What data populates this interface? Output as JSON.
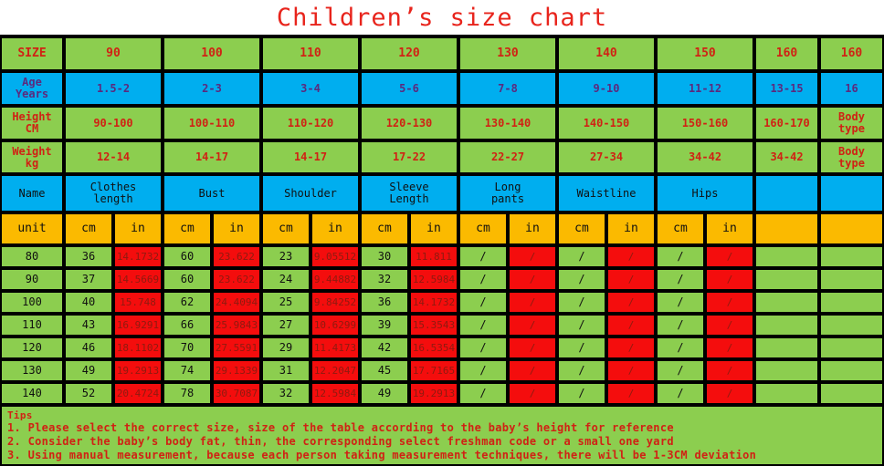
{
  "title": "Children’s size chart",
  "colors": {
    "green": "#8CCE4F",
    "blue": "#00AEEF",
    "orange": "#FBBA00",
    "red": "#F40D0D",
    "title_red": "#E8241C",
    "text_red": "#D02214",
    "text_purple": "#5B2A7E"
  },
  "top_table": {
    "size_row": {
      "label": "SIZE",
      "values": [
        "90",
        "100",
        "110",
        "120",
        "130",
        "140",
        "150",
        "160",
        "160"
      ]
    },
    "age_row": {
      "label": "Age\nYears",
      "values": [
        "1.5-2",
        "2-3",
        "3-4",
        "5-6",
        "7-8",
        "9-10",
        "11-12",
        "13-15",
        "16"
      ]
    },
    "height_row": {
      "label": "Height\nCM",
      "values": [
        "90-100",
        "100-110",
        "110-120",
        "120-130",
        "130-140",
        "140-150",
        "150-160",
        "160-170",
        "Body\ntype"
      ]
    },
    "weight_row": {
      "label": "Weight\nkg",
      "values": [
        "12-14",
        "14-17",
        "14-17",
        "17-22",
        "22-27",
        "27-34",
        "34-42",
        "34-42",
        "Body\ntype"
      ]
    },
    "name_row": {
      "label": "Name",
      "values": [
        "Clothes\nlength",
        "Bust",
        "Shoulder",
        "Sleeve\nLength",
        "Long\npants",
        "Waistline",
        "Hips",
        "",
        ""
      ]
    }
  },
  "measure_table": {
    "unit_row": {
      "label": "unit",
      "cm_label": "cm",
      "in_label": "in",
      "measure_count": 7,
      "empty_cols": 2
    },
    "rows": [
      {
        "size": "80",
        "cells": [
          "36",
          "14.1732",
          "60",
          "23.622",
          "23",
          "9.05512",
          "30",
          "11.811",
          "/",
          "/",
          "/",
          "/",
          "/",
          "/"
        ]
      },
      {
        "size": "90",
        "cells": [
          "37",
          "14.5669",
          "60",
          "23.622",
          "24",
          "9.44882",
          "32",
          "12.5984",
          "/",
          "/",
          "/",
          "/",
          "/",
          "/"
        ]
      },
      {
        "size": "100",
        "cells": [
          "40",
          "15.748",
          "62",
          "24.4094",
          "25",
          "9.84252",
          "36",
          "14.1732",
          "/",
          "/",
          "/",
          "/",
          "/",
          "/"
        ]
      },
      {
        "size": "110",
        "cells": [
          "43",
          "16.9291",
          "66",
          "25.9843",
          "27",
          "10.6299",
          "39",
          "15.3543",
          "/",
          "/",
          "/",
          "/",
          "/",
          "/"
        ]
      },
      {
        "size": "120",
        "cells": [
          "46",
          "18.1102",
          "70",
          "27.5591",
          "29",
          "11.4173",
          "42",
          "16.5354",
          "/",
          "/",
          "/",
          "/",
          "/",
          "/"
        ]
      },
      {
        "size": "130",
        "cells": [
          "49",
          "19.2913",
          "74",
          "29.1339",
          "31",
          "12.2047",
          "45",
          "17.7165",
          "/",
          "/",
          "/",
          "/",
          "/",
          "/"
        ]
      },
      {
        "size": "140",
        "cells": [
          "52",
          "20.4724",
          "78",
          "30.7087",
          "32",
          "12.5984",
          "49",
          "19.2913",
          "/",
          "/",
          "/",
          "/",
          "/",
          "/"
        ]
      }
    ]
  },
  "tips": {
    "heading": "Tips",
    "lines": [
      "1. Please select the correct size, size of the table according to the baby’s height for reference",
      "2. Consider the baby’s body fat, thin, the corresponding select freshman code or a small one yard",
      "3. Using manual measurement, because each person taking measurement techniques, there will be 1-3CM deviation"
    ]
  }
}
